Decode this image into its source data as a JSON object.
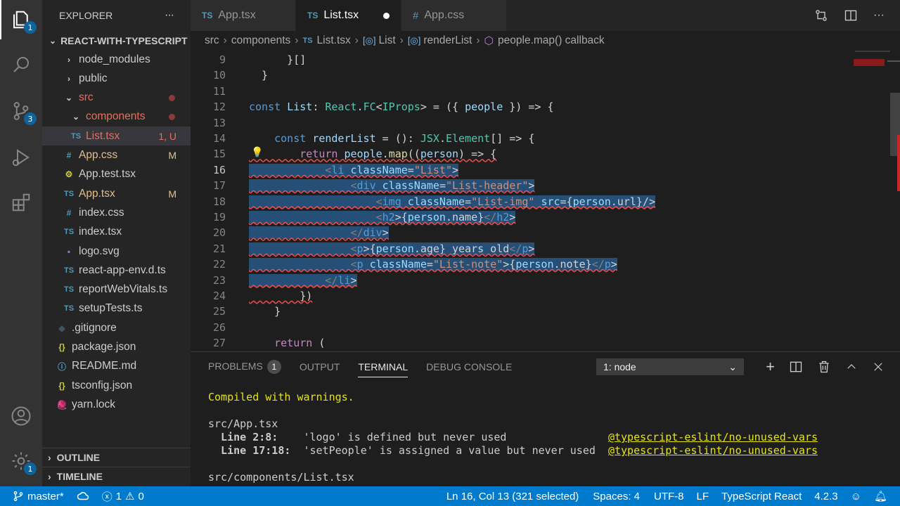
{
  "activity_bar": {
    "explorer_badge": "1",
    "scm_badge": "3",
    "settings_badge": "1"
  },
  "sidebar": {
    "title": "EXPLORER",
    "more": "···",
    "project": "REACT-WITH-TYPESCRIPT",
    "items": [
      {
        "label": "node_modules",
        "icon": "›",
        "badge": ""
      },
      {
        "label": "public",
        "icon": "›",
        "badge": ""
      },
      {
        "label": "src",
        "icon": "⌄",
        "badge": ""
      },
      {
        "label": "components",
        "icon": "⌄",
        "badge": ""
      },
      {
        "label": "List.tsx",
        "icon": "TS",
        "badge": "1, U"
      },
      {
        "label": "App.css",
        "icon": "#",
        "badge": "M"
      },
      {
        "label": "App.test.tsx",
        "icon": "⚙",
        "badge": ""
      },
      {
        "label": "App.tsx",
        "icon": "TS",
        "badge": "M"
      },
      {
        "label": "index.css",
        "icon": "#",
        "badge": ""
      },
      {
        "label": "index.tsx",
        "icon": "TS",
        "badge": ""
      },
      {
        "label": "logo.svg",
        "icon": "▪",
        "badge": ""
      },
      {
        "label": "react-app-env.d.ts",
        "icon": "TS",
        "badge": ""
      },
      {
        "label": "reportWebVitals.ts",
        "icon": "TS",
        "badge": ""
      },
      {
        "label": "setupTests.ts",
        "icon": "TS",
        "badge": ""
      },
      {
        "label": ".gitignore",
        "icon": "◆",
        "badge": ""
      },
      {
        "label": "package.json",
        "icon": "{}",
        "badge": ""
      },
      {
        "label": "README.md",
        "icon": "ⓘ",
        "badge": ""
      },
      {
        "label": "tsconfig.json",
        "icon": "{}",
        "badge": ""
      },
      {
        "label": "yarn.lock",
        "icon": "🧶",
        "badge": ""
      }
    ],
    "outline": "OUTLINE",
    "timeline": "TIMELINE"
  },
  "tabs": [
    {
      "prefix": "TS",
      "label": "App.tsx"
    },
    {
      "prefix": "TS",
      "label": "List.tsx"
    },
    {
      "prefix": "#",
      "label": "App.css"
    }
  ],
  "breadcrumb": [
    "src",
    "components",
    "List.tsx",
    "List",
    "renderList",
    "people.map() callback"
  ],
  "editor": {
    "lines": [
      {
        "n": "9",
        "t": "      }[]"
      },
      {
        "n": "10",
        "t": "  }"
      },
      {
        "n": "11",
        "t": ""
      },
      {
        "n": "12",
        "t": "const List: React.FC<IProps> = ({ people }) => {"
      },
      {
        "n": "13",
        "t": ""
      },
      {
        "n": "14",
        "t": "    const renderList = (): JSX.Element[] => {"
      },
      {
        "n": "15",
        "t": "        return people.map((person) => {"
      },
      {
        "n": "16",
        "t": "            <li className=\"List\">"
      },
      {
        "n": "17",
        "t": "                <div className=\"List-header\">"
      },
      {
        "n": "18",
        "t": "                    <img className=\"List-img\" src={person.url}/>"
      },
      {
        "n": "19",
        "t": "                    <h2>{person.name}</h2>"
      },
      {
        "n": "20",
        "t": "                </div>"
      },
      {
        "n": "21",
        "t": "                <p>{person.age} years old</p>"
      },
      {
        "n": "22",
        "t": "                <p className=\"List-note\">{person.note}</p>"
      },
      {
        "n": "23",
        "t": "            </li>"
      },
      {
        "n": "24",
        "t": "        })"
      },
      {
        "n": "25",
        "t": "    }"
      },
      {
        "n": "26",
        "t": ""
      },
      {
        "n": "27",
        "t": "    return ("
      }
    ]
  },
  "panel": {
    "tabs": [
      "PROBLEMS",
      "OUTPUT",
      "TERMINAL",
      "DEBUG CONSOLE"
    ],
    "problems_count": "1",
    "terminal_select": "1: node",
    "terminal_lines": [
      "Compiled with warnings.",
      "",
      "src/App.tsx",
      "  Line 2:8:    'logo' is defined but never used                @typescript-eslint/no-unused-vars",
      "  Line 17:18:  'setPeople' is assigned a value but never used  @typescript-eslint/no-unused-vars",
      "",
      "src/components/List.tsx"
    ]
  },
  "status": {
    "branch": "master*",
    "errors": "1",
    "warnings": "0",
    "position": "Ln 16, Col 13 (321 selected)",
    "spaces": "Spaces: 4",
    "encoding": "UTF-8",
    "eol": "LF",
    "language": "TypeScript React",
    "version": "4.2.3"
  },
  "colors": {
    "status_bar": "#007acc",
    "selection": "#264f78",
    "error": "#f14c4c"
  }
}
